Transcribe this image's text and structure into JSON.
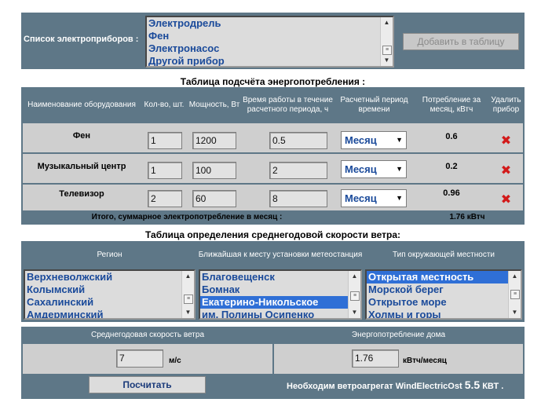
{
  "devices_panel": {
    "label": "Список электроприборов :",
    "options": [
      "Электродрель",
      "Фен",
      "Электронасос",
      "Другой прибор"
    ],
    "add_button": "Добавить в таблицу"
  },
  "energy_table": {
    "title": "Таблица подсчёта энергопотребления :",
    "headers": [
      "Наименование оборудования",
      "Кол-во, шт.",
      "Мощность, Вт",
      "Время работы в течение расчетного периода, ч",
      "Расчетный период времени",
      "Потребление за месяц, кВтч",
      "Удалить прибор"
    ],
    "rows": [
      {
        "name": "Фен",
        "qty": "1",
        "power": "1200",
        "hours": "0.5",
        "period": "Месяц",
        "consumption": "0.6"
      },
      {
        "name": "Музыкальный центр",
        "qty": "1",
        "power": "100",
        "hours": "2",
        "period": "Месяц",
        "consumption": "0.2"
      },
      {
        "name": "Телевизор",
        "qty": "2",
        "power": "60",
        "hours": "8",
        "period": "Месяц",
        "consumption": "0.96"
      }
    ],
    "delete_glyph": "✖",
    "total_label": "Итого, суммарное электропотребление в месяц :",
    "total_value": "1.76 кВтч"
  },
  "wind_table": {
    "title": "Таблица определения среднегодовой скорости ветра:",
    "headers": [
      "Регион",
      "Ближайшая к месту установки метеостанция",
      "Тип окружающей местности"
    ],
    "regions": [
      "Верхневолжский",
      "Колымский",
      "Сахалинский",
      "Амдерминский"
    ],
    "stations": [
      "Благовещенск",
      "Бомнак",
      "Екатерино-Никольское",
      "им. Полины Осипенко"
    ],
    "station_selected": 2,
    "terrain": [
      "Открытая местность",
      "Морской берег",
      "Открытое море",
      "Холмы и горы"
    ],
    "terrain_selected": 0
  },
  "result_panel": {
    "wind_label": "Среднегодовая скорость ветра",
    "wind_value": "7",
    "wind_unit": "м/с",
    "energy_label": "Энергопотребление дома",
    "energy_value": "1.76",
    "energy_unit": "кВтч/месяц",
    "calc_button": "Посчитать",
    "result_prefix": "Необходим ветроагрегат WindElectricOst",
    "result_value": "5.5",
    "result_unit": "КВТ ."
  },
  "colors": {
    "header_bg": "#5e7787",
    "cell_bg": "#cfcfcf",
    "option_text": "#1a4a9a",
    "selected_bg": "#2f6fd6",
    "delete_icon": "#d21a1a"
  }
}
